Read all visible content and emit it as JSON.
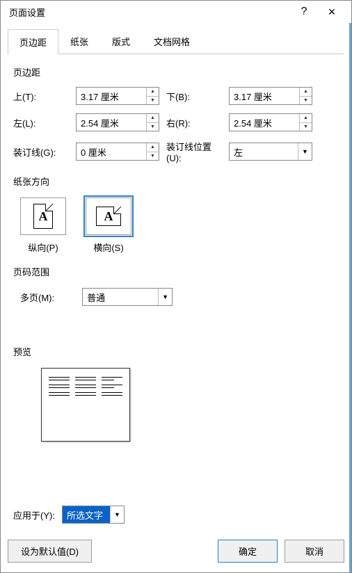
{
  "title": "页面设置",
  "help_symbol": "?",
  "close_symbol": "×",
  "tabs": [
    "页边距",
    "纸张",
    "版式",
    "文档网格"
  ],
  "active_tab": 0,
  "sections": {
    "margins": {
      "title": "页边距",
      "top": {
        "label": "上(T):",
        "value": "3.17 厘米"
      },
      "bottom": {
        "label": "下(B):",
        "value": "3.17 厘米"
      },
      "left": {
        "label": "左(L):",
        "value": "2.54 厘米"
      },
      "right": {
        "label": "右(R):",
        "value": "2.54 厘米"
      },
      "gutter": {
        "label": "装订线(G):",
        "value": "0 厘米"
      },
      "gutter_pos": {
        "label": "装订线位置(U):",
        "value": "左"
      }
    },
    "orientation": {
      "title": "纸张方向",
      "portrait": "纵向(P)",
      "landscape": "横向(S)",
      "selected": "landscape"
    },
    "page_range": {
      "title": "页码范围",
      "multi_label": "多页(M):",
      "multi_value": "普通"
    },
    "preview": {
      "title": "预览"
    },
    "apply": {
      "label": "应用于(Y):",
      "value": "所选文字"
    }
  },
  "buttons": {
    "set_default": "设为默认值(D)",
    "ok": "确定",
    "cancel": "取消"
  }
}
